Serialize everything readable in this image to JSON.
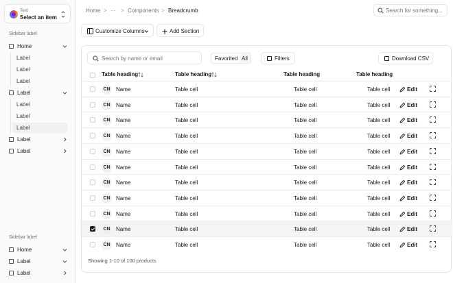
{
  "selector": {
    "caption": "Text",
    "value": "Select an item"
  },
  "sidebar": {
    "group1_label": "Sidebar label",
    "group1": [
      {
        "label": "Home",
        "chevron": "down",
        "children": [
          "Label",
          "Label",
          "Label"
        ]
      },
      {
        "label": "Label",
        "chevron": "down",
        "children": [
          "Label",
          "Label",
          "Label"
        ],
        "active_child": 2
      },
      {
        "label": "Label",
        "chevron": "right"
      },
      {
        "label": "Label",
        "chevron": "right"
      }
    ],
    "group2_label": "Sidebar label",
    "group2": [
      {
        "label": "Home",
        "chevron": "down"
      },
      {
        "label": "Label",
        "chevron": "down"
      },
      {
        "label": "Label",
        "chevron": "right"
      }
    ]
  },
  "breadcrumb": {
    "home": "Home",
    "ellipsis": "···",
    "components": "Components",
    "current": "Breadcrumb"
  },
  "top_search": {
    "placeholder": "Search for something..."
  },
  "toolbar": {
    "customize_label": "Customize Columns",
    "add_section_label": "Add Section"
  },
  "table_controls": {
    "search_placeholder": "Search by name or email",
    "favorited_label": "Favorited",
    "all_label": "All",
    "filters_label": "Filters",
    "download_label": "Download CSV"
  },
  "table": {
    "headers": [
      "Table heading",
      "Table heading",
      "Table heading",
      "Table heading"
    ],
    "rows": [
      {
        "initials": "CN",
        "name": "Name",
        "c1": "Table cell",
        "c2": "Table cell",
        "c3": "Table cell",
        "action": "Edit",
        "checked": false
      },
      {
        "initials": "CN",
        "name": "Name",
        "c1": "Table cell",
        "c2": "Table cell",
        "c3": "Table cell",
        "action": "Edit",
        "checked": false
      },
      {
        "initials": "CN",
        "name": "Name",
        "c1": "Table cell",
        "c2": "Table cell",
        "c3": "Table cell",
        "action": "Edit",
        "checked": false
      },
      {
        "initials": "CN",
        "name": "Name",
        "c1": "Table cell",
        "c2": "Table cell",
        "c3": "Table cell",
        "action": "Edit",
        "checked": false
      },
      {
        "initials": "CN",
        "name": "Name",
        "c1": "Table cell",
        "c2": "Table cell",
        "c3": "Table cell",
        "action": "Edit",
        "checked": false
      },
      {
        "initials": "CN",
        "name": "Name",
        "c1": "Table cell",
        "c2": "Table cell",
        "c3": "Table cell",
        "action": "Edit",
        "checked": false
      },
      {
        "initials": "CN",
        "name": "Name",
        "c1": "Table cell",
        "c2": "Table cell",
        "c3": "Table cell",
        "action": "Edit",
        "checked": false
      },
      {
        "initials": "CN",
        "name": "Name",
        "c1": "Table cell",
        "c2": "Table cell",
        "c3": "Table cell",
        "action": "Edit",
        "checked": false
      },
      {
        "initials": "CN",
        "name": "Name",
        "c1": "Table cell",
        "c2": "Table cell",
        "c3": "Table cell",
        "action": "Edit",
        "checked": false
      },
      {
        "initials": "CN",
        "name": "Name",
        "c1": "Table cell",
        "c2": "Table cell",
        "c3": "Table cell",
        "action": "Edit",
        "checked": true
      },
      {
        "initials": "CN",
        "name": "Name",
        "c1": "Table cell",
        "c2": "Table cell",
        "c3": "Table cell",
        "action": "Edit",
        "checked": false
      }
    ],
    "footer": "Showing 1-10 of 100 products"
  },
  "colors": {
    "text": "#18181b",
    "muted": "#71717a",
    "border": "#e4e4e7",
    "selected_row": "#f4f4f5"
  },
  "icons": [
    "chevron-up-down-icon",
    "checkbox-icon",
    "chevron-down-icon",
    "chevron-right-icon",
    "search-icon",
    "columns-icon",
    "plus-icon",
    "sort-icon",
    "square-icon",
    "pencil-icon",
    "more-icon"
  ]
}
